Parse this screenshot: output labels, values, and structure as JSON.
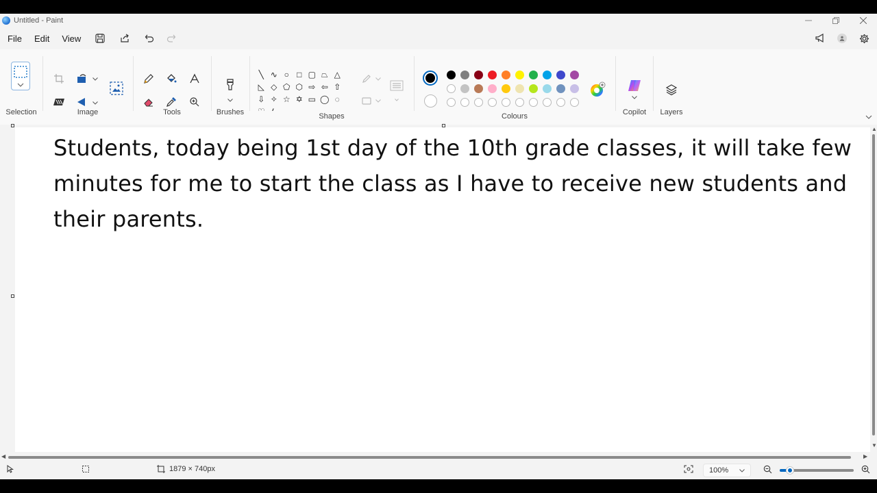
{
  "window": {
    "title": "Untitled - Paint"
  },
  "menu": {
    "file": "File",
    "edit": "Edit",
    "view": "View"
  },
  "ribbon": {
    "selection_label": "Selection",
    "image_label": "Image",
    "tools_label": "Tools",
    "brushes_label": "Brushes",
    "shapes_label": "Shapes",
    "colours_label": "Colours",
    "copilot_label": "Copilot",
    "layers_label": "Layers"
  },
  "palette": {
    "primary": "#000000",
    "secondary": "#ffffff",
    "row1": [
      "#000000",
      "#7f7f7f",
      "#880015",
      "#ed1c24",
      "#ff7f27",
      "#fff200",
      "#22b14c",
      "#00a2e8",
      "#3f48cc",
      "#a349a4"
    ],
    "row2": [
      "#ffffff",
      "#c3c3c3",
      "#b97a57",
      "#ffaec9",
      "#ffc90e",
      "#efe4b0",
      "#b5e61d",
      "#99d9ea",
      "#7092be",
      "#c8bfe7"
    ]
  },
  "canvas": {
    "text": "Students, today being 1st day of the 10th grade classes, it will take few minutes for me to start the class as I have to receive new students and their parents."
  },
  "status": {
    "dimensions": "1879 × 740px",
    "zoom": "100%"
  },
  "accent": "#0067c0"
}
